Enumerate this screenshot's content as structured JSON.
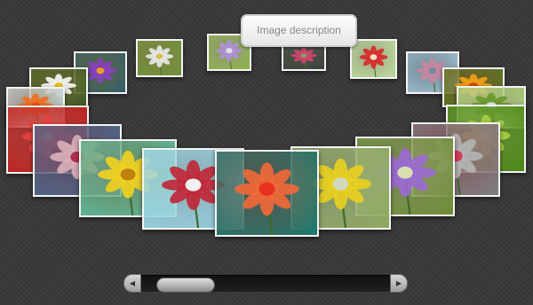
{
  "tooltip": {
    "text": "Image description"
  },
  "scrollbar": {
    "left_arrow": "◀",
    "right_arrow": "▶",
    "thumb_position": 0.08
  },
  "gallery": {
    "images": [
      {
        "subject": "spiky white daisy on green",
        "palette": [
          "#6d8f3e",
          "#e8e8e8",
          "#d9c24a"
        ]
      },
      {
        "subject": "small purple flower",
        "palette": [
          "#8fb04a",
          "#b090d8",
          "#e0e0e0"
        ]
      },
      {
        "subject": "pink bud on dark",
        "palette": [
          "#3d3f3d",
          "#d24470",
          "#7e9f6c"
        ]
      },
      {
        "subject": "red spiky flower",
        "palette": [
          "#b8d89a",
          "#d82a2a",
          "#f0e0c0"
        ]
      },
      {
        "subject": "purple water lily",
        "palette": [
          "#2d5f6c",
          "#8a3fc0",
          "#e8a020"
        ]
      },
      {
        "subject": "pink orchids",
        "palette": [
          "#9fbfcf",
          "#c885a0",
          "#6e8c98"
        ]
      },
      {
        "subject": "white daisies",
        "palette": [
          "#3e5a2a",
          "#f5f5f5",
          "#e8c020"
        ]
      },
      {
        "subject": "orange marigold",
        "palette": [
          "#c0e0e8",
          "#f07020",
          "#e85010"
        ]
      },
      {
        "subject": "orange gerbera",
        "palette": [
          "#587a2a",
          "#f4a018",
          "#d05008"
        ]
      },
      {
        "subject": "green leaves",
        "palette": [
          "#a8c870",
          "#6a9a30",
          "#e8e8e8"
        ]
      },
      {
        "subject": "red petals",
        "palette": [
          "#c02020",
          "#e84040",
          "#f08060"
        ]
      },
      {
        "subject": "yellow leaf",
        "palette": [
          "#4a8818",
          "#a8d040",
          "#d0e080"
        ]
      },
      {
        "subject": "striped orchid",
        "palette": [
          "#4a6a8a",
          "#d8b0b8",
          "#b03050"
        ]
      },
      {
        "subject": "grey flower",
        "palette": [
          "#7e7e7e",
          "#b4b4b4",
          "#d23a5a"
        ]
      },
      {
        "subject": "yellow flower on teal",
        "palette": [
          "#5abaa0",
          "#f0d020",
          "#c08010"
        ]
      },
      {
        "subject": "green stems with purple flower",
        "palette": [
          "#6f8c3a",
          "#9a6ad0",
          "#d8e0b0"
        ]
      },
      {
        "subject": "red lily on blue",
        "palette": [
          "#8fd0e0",
          "#c02838",
          "#f0f0f0"
        ]
      },
      {
        "subject": "yellow field flowers",
        "palette": [
          "#8ea860",
          "#e8d020",
          "#d0d8c0"
        ]
      },
      {
        "subject": "hibiscus stamen",
        "palette": [
          "#1e7a70",
          "#f06838",
          "#e83020"
        ]
      }
    ]
  }
}
